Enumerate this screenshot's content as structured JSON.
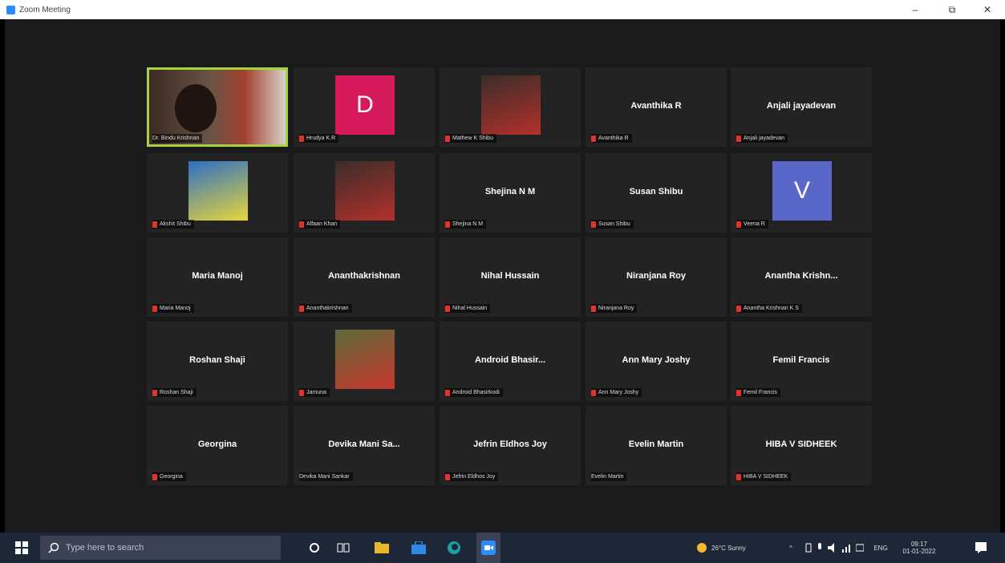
{
  "window": {
    "title": "Zoom Meeting",
    "minimize": "–",
    "maximize": "⧉",
    "close": "✕"
  },
  "participants": [
    {
      "display": "",
      "label": "Dr. Bindu Krishnan",
      "mic_muted": false,
      "video": true,
      "active": true
    },
    {
      "display": "D",
      "label": "Hrudya K.R",
      "mic_muted": true,
      "avatar_letter": "D",
      "avatar_color": "#d6195a"
    },
    {
      "display": "",
      "label": "Mathew K Shibu",
      "mic_muted": true,
      "photo": true
    },
    {
      "display": "Avanthika R",
      "label": "Avanthika R",
      "mic_muted": true
    },
    {
      "display": "Anjali jayadevan",
      "label": "Anjali jayadevan",
      "mic_muted": true
    },
    {
      "display": "",
      "label": "Akshit Shibu",
      "mic_muted": true,
      "photo": true
    },
    {
      "display": "",
      "label": "Alfaan Khan",
      "mic_muted": true,
      "photo": true
    },
    {
      "display": "Shejina N M",
      "label": "Shejina N M",
      "mic_muted": true
    },
    {
      "display": "Susan Shibu",
      "label": "Susan Shibu",
      "mic_muted": true
    },
    {
      "display": "V",
      "label": "Veena R",
      "mic_muted": true,
      "avatar_letter": "V",
      "avatar_color": "#5967c9"
    },
    {
      "display": "Maria Manoj",
      "label": "Maria Manoj",
      "mic_muted": true
    },
    {
      "display": "Ananthakrishnan",
      "label": "Ananthakrishnan",
      "mic_muted": true
    },
    {
      "display": "Nihal Hussain",
      "label": "Nihal Hussain",
      "mic_muted": true
    },
    {
      "display": "Niranjana Roy",
      "label": "Niranjana Roy",
      "mic_muted": true
    },
    {
      "display": "Anantha Krishn...",
      "label": "Anantha Krishnan K S",
      "mic_muted": true
    },
    {
      "display": "Roshan Shaji",
      "label": "Roshan Shaji",
      "mic_muted": true
    },
    {
      "display": "",
      "label": "Jamuna",
      "mic_muted": true,
      "photo": true
    },
    {
      "display": "Android Bhasir...",
      "label": "Android Bhasirkodi",
      "mic_muted": true
    },
    {
      "display": "Ann Mary Joshy",
      "label": "Ann Mary Joshy",
      "mic_muted": true
    },
    {
      "display": "Femil Francis",
      "label": "Femil Francis",
      "mic_muted": true
    },
    {
      "display": "Georgina",
      "label": "Georgina",
      "mic_muted": true
    },
    {
      "display": "Devika Mani Sa...",
      "label": "Devika Mani Sankar",
      "mic_muted": false
    },
    {
      "display": "Jefrin Eldhos Joy",
      "label": "Jefrin Eldhos Joy",
      "mic_muted": true
    },
    {
      "display": "Evelin Martin",
      "label": "Evelin Martin",
      "mic_muted": false
    },
    {
      "display": "HIBA V SIDHEEK",
      "label": "HIBA V SIDHEEK",
      "mic_muted": true
    }
  ],
  "taskbar": {
    "search_placeholder": "Type here to search",
    "weather": "26°C  Sunny",
    "language": "ENG",
    "time": "09:17",
    "date": "01-01-2022"
  },
  "colors": {
    "active_border": "#a6d23b",
    "muted_mic": "#e0332b"
  }
}
